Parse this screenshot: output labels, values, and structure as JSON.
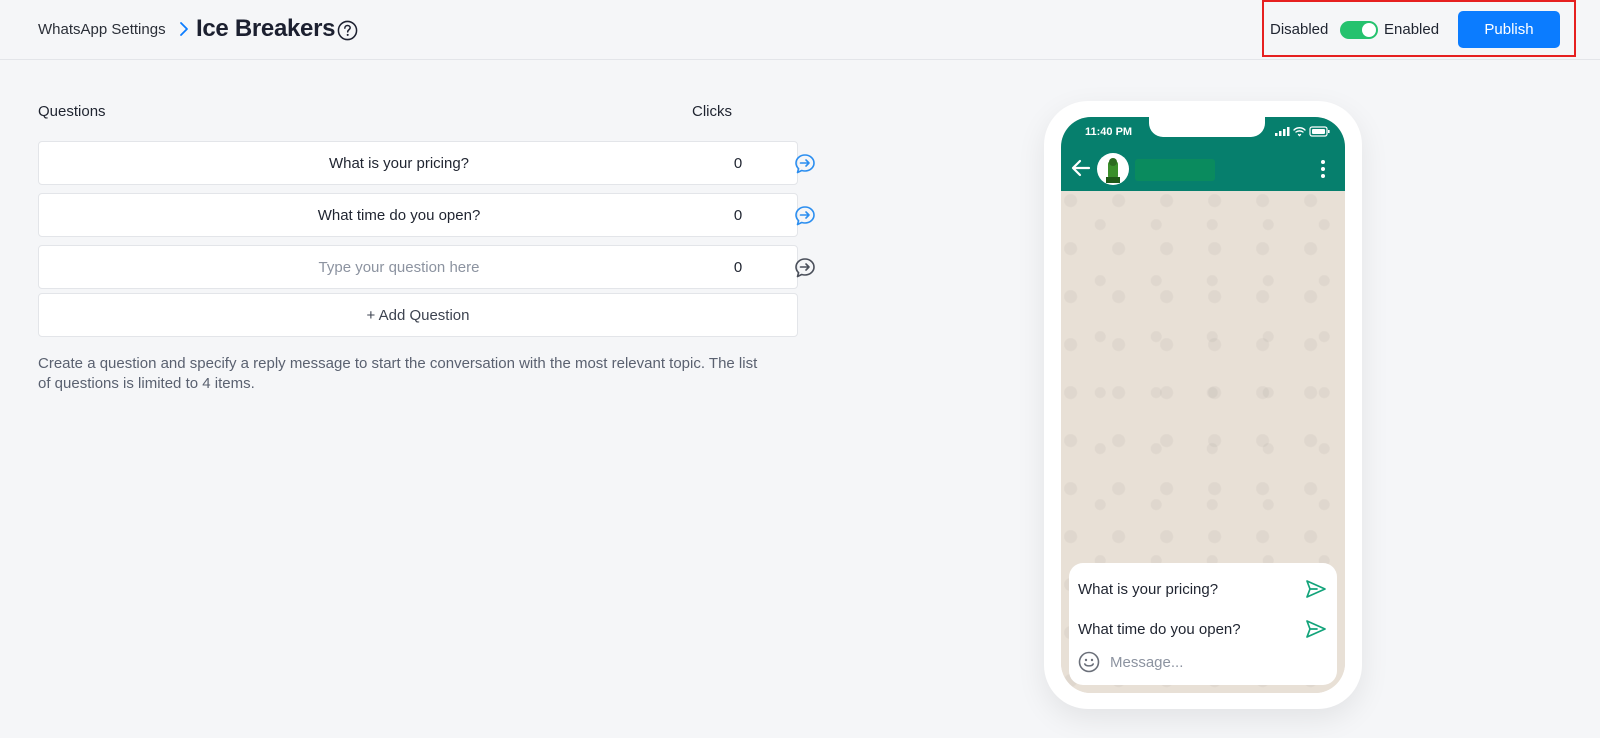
{
  "header": {
    "breadcrumb_parent": "WhatsApp Settings",
    "title": "Ice Breakers",
    "toggle": {
      "off_label": "Disabled",
      "on_label": "Enabled",
      "state": "enabled"
    },
    "publish_label": "Publish"
  },
  "questions_table": {
    "col_questions": "Questions",
    "col_clicks": "Clicks",
    "rows": [
      {
        "text": "What is your pricing?",
        "clicks": "0",
        "placeholder": false
      },
      {
        "text": "What time do you open?",
        "clicks": "0",
        "placeholder": false
      },
      {
        "text": "Type your question here",
        "clicks": "0",
        "placeholder": true
      }
    ],
    "add_label": "+ Add Question",
    "help_text_line1": "Create a question and specify a reply message to start the conversation with the most relevant topic. The list",
    "help_text_line2": "of questions is limited to 4 items."
  },
  "phone_preview": {
    "time": "11:40 PM",
    "ice_breakers": [
      "What is your pricing?",
      "What time do you open?"
    ],
    "message_placeholder": "Message..."
  },
  "colors": {
    "accent": "#0b7cff",
    "toggle_on": "#25c26e",
    "whatsapp_green": "#067f6d",
    "highlight": "#e62020"
  }
}
